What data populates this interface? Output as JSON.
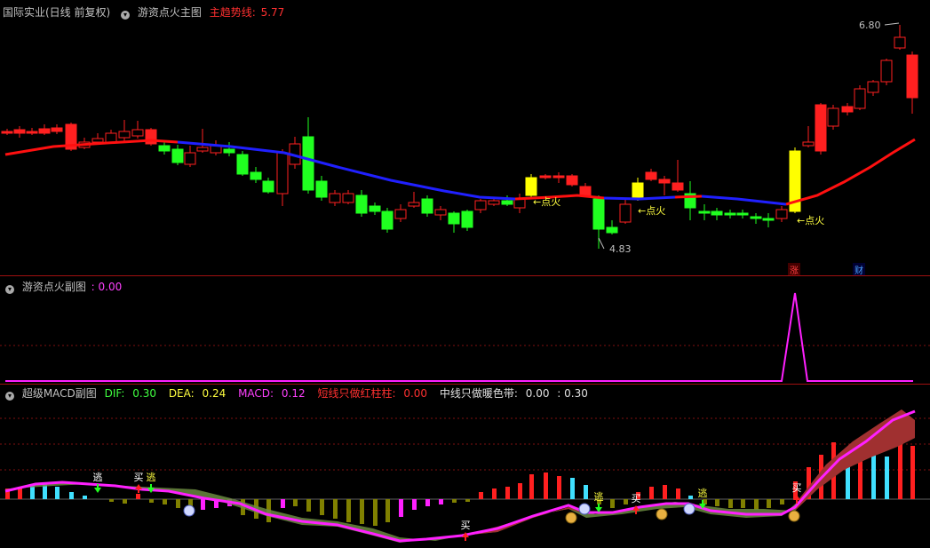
{
  "main_panel": {
    "title": "国际实业(日线 前复权)",
    "indicator": "游资点火主图",
    "trend_label": "主趋势线:",
    "trend_value": "5.77",
    "high_label": "6.80",
    "low_label": "4.83",
    "ignite_labels": [
      "←点火",
      "←点火",
      "←点火"
    ],
    "event_badges": [
      {
        "text": "涨",
        "color": "#ff4040"
      },
      {
        "text": "财",
        "color": "#4aa0ff"
      }
    ]
  },
  "sub_panel": {
    "title": "游资点火副图",
    "value": "0.00"
  },
  "macd_panel": {
    "title": "超级MACD副图",
    "dif_label": "DIF:",
    "dif_value": "0.30",
    "dea_label": "DEA:",
    "dea_value": "0.24",
    "macd_label": "MACD:",
    "macd_value": "0.12",
    "short_label": "短线只做红柱柱:",
    "short_value": "0.00",
    "mid_label": "中线只做暖色带:",
    "mid_value": "0.00",
    "extra_value": ": 0.30",
    "signals": [
      "逃",
      "买",
      "逃",
      "买",
      "逃",
      "买",
      "逃",
      "买"
    ]
  },
  "colors": {
    "up": "#ff2020",
    "down": "#20ff20",
    "ignite": "#ffff00",
    "trend_up": "#ff1010",
    "trend_down": "#2020ff",
    "magenta": "#ff20ff",
    "grid": "#801010"
  }
}
